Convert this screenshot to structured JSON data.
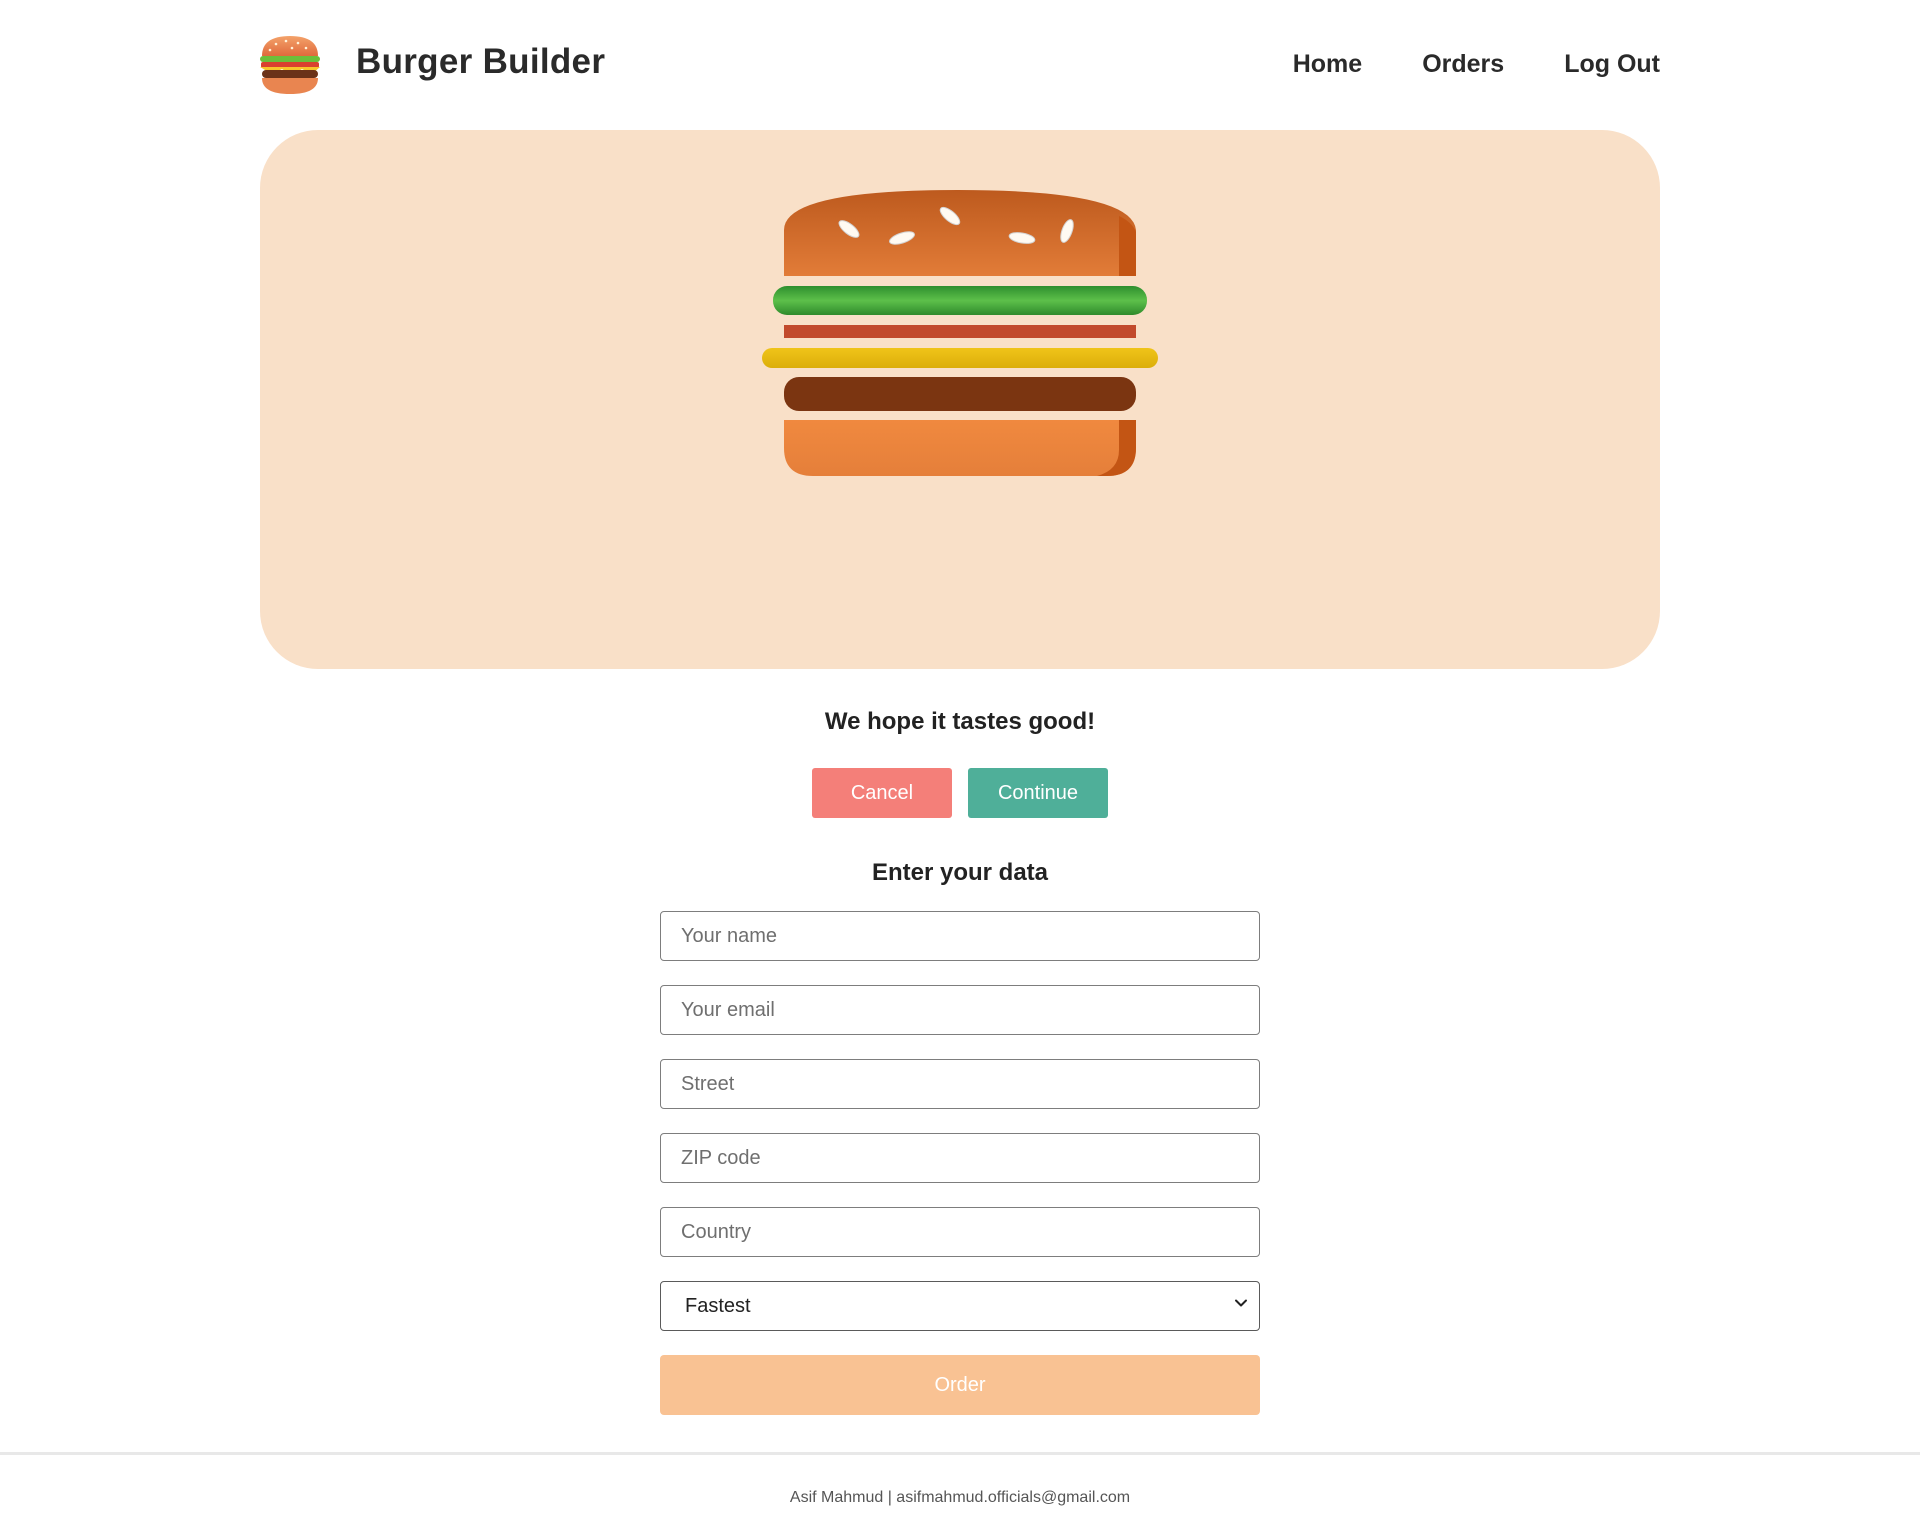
{
  "header": {
    "title": "Burger Builder",
    "nav": {
      "home": "Home",
      "orders": "Orders",
      "logout": "Log Out"
    }
  },
  "summary": {
    "message": "We hope it tastes good!",
    "cancel_label": "Cancel",
    "continue_label": "Continue"
  },
  "form": {
    "title": "Enter your data",
    "name_placeholder": "Your name",
    "email_placeholder": "Your email",
    "street_placeholder": "Street",
    "zip_placeholder": "ZIP code",
    "country_placeholder": "Country",
    "delivery_selected": "Fastest",
    "order_label": "Order"
  },
  "footer": {
    "text": "Asif Mahmud | asifmahmud.officials@gmail.com"
  },
  "colors": {
    "preview_bg": "#f9e0c8",
    "cancel": "#f47f79",
    "continue": "#4faf99",
    "order": "#f9c293"
  },
  "icons": [
    "burger-logo-icon",
    "chevron-down-icon"
  ]
}
